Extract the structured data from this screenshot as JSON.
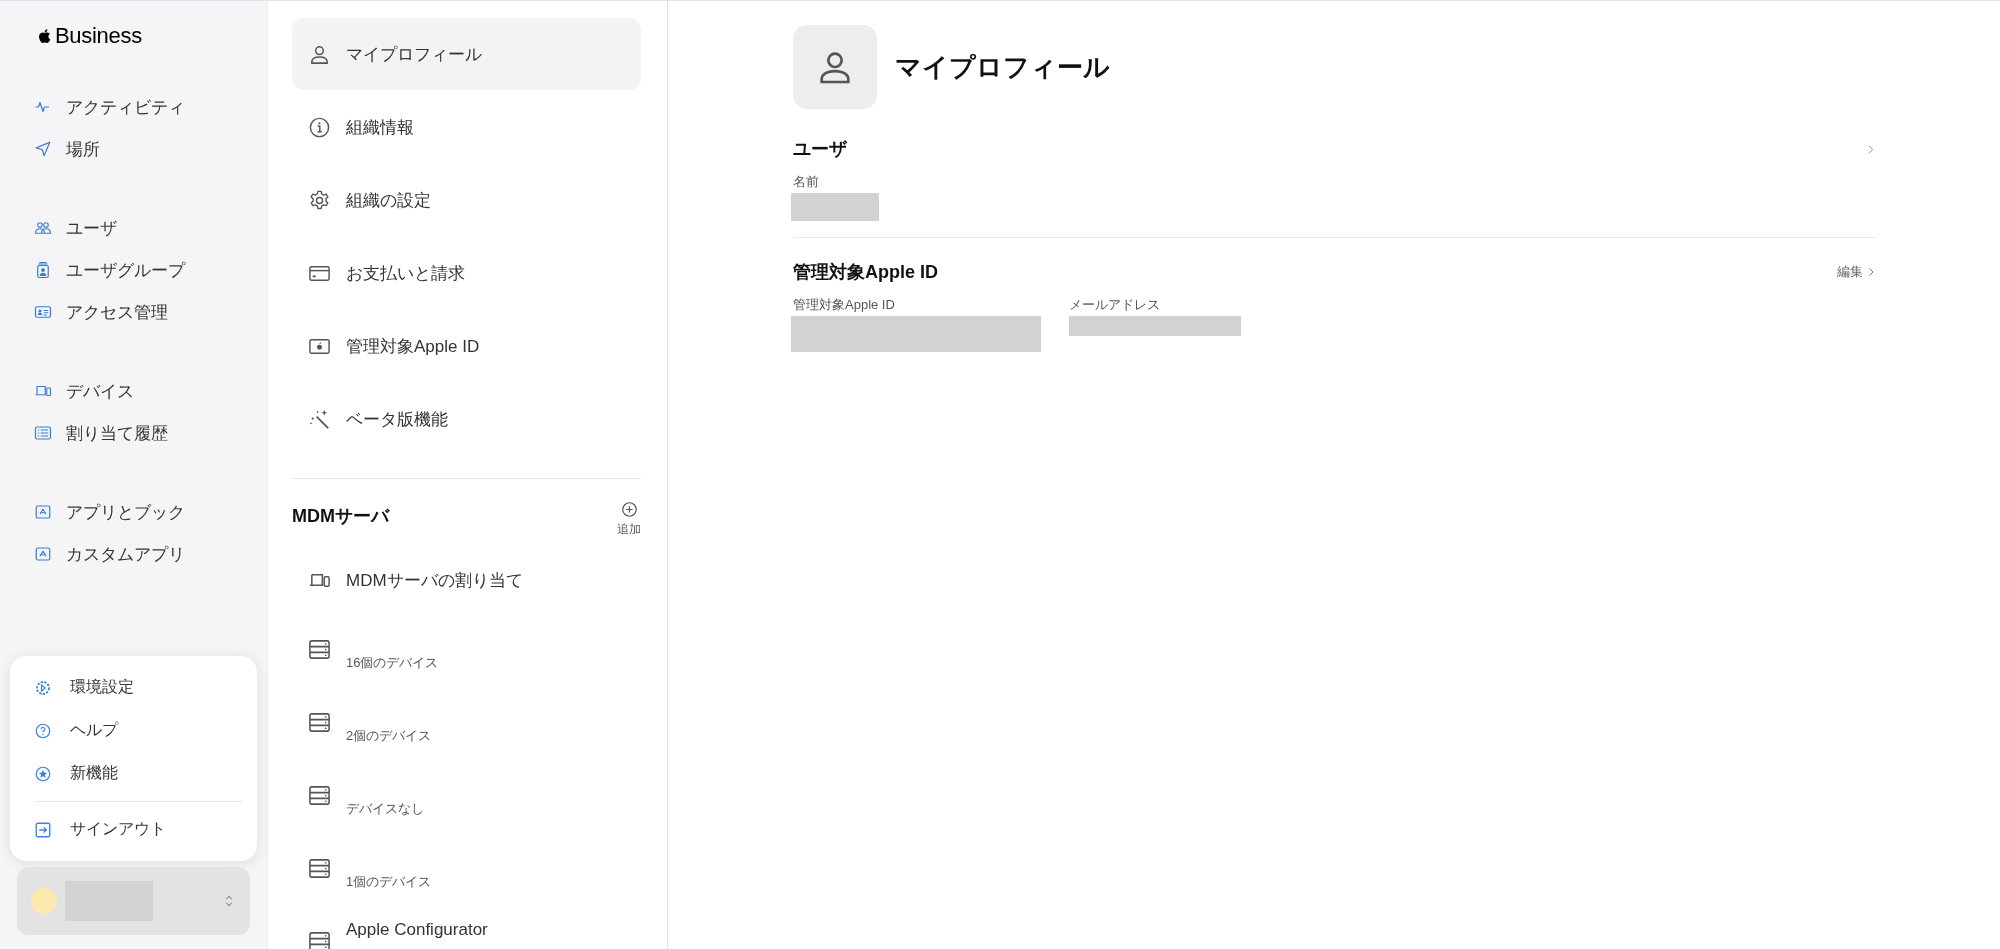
{
  "sidebar": {
    "logo": "Business",
    "groups": [
      {
        "items": [
          {
            "label": "アクティビティ"
          },
          {
            "label": "場所"
          }
        ]
      },
      {
        "items": [
          {
            "label": "ユーザ"
          },
          {
            "label": "ユーザグループ"
          },
          {
            "label": "アクセス管理"
          }
        ]
      },
      {
        "items": [
          {
            "label": "デバイス"
          },
          {
            "label": "割り当て履歴"
          }
        ]
      },
      {
        "items": [
          {
            "label": "アプリとブック"
          },
          {
            "label": "カスタムアプリ"
          }
        ]
      }
    ]
  },
  "popup_menu": {
    "items": [
      {
        "label": "環境設定"
      },
      {
        "label": "ヘルプ"
      },
      {
        "label": "新機能"
      }
    ],
    "sign_out": "サインアウト"
  },
  "settings_nav": {
    "items": [
      {
        "label": "マイプロフィール",
        "selected": true
      },
      {
        "label": "組織情報",
        "selected": false
      },
      {
        "label": "組織の設定",
        "selected": false
      },
      {
        "label": "お支払いと請求",
        "selected": false
      },
      {
        "label": "管理対象Apple ID",
        "selected": false
      },
      {
        "label": "ベータ版機能",
        "selected": false
      }
    ]
  },
  "mdm": {
    "title": "MDMサーバ",
    "add_label": "追加",
    "items": [
      {
        "kind": "assign",
        "label": "MDMサーバの割り当て"
      },
      {
        "kind": "server",
        "subtitle": "16個のデバイス"
      },
      {
        "kind": "server",
        "subtitle": "2個のデバイス"
      },
      {
        "kind": "server",
        "subtitle": "デバイスなし"
      },
      {
        "kind": "server",
        "subtitle": "1個のデバイス"
      },
      {
        "kind": "server",
        "label": "Apple Configurator"
      }
    ]
  },
  "profile": {
    "title": "マイプロフィール",
    "sections": [
      {
        "kind": "user",
        "title": "ユーザ",
        "fields": [
          {
            "label": "名前"
          }
        ]
      },
      {
        "kind": "apple_id",
        "title": "管理対象Apple ID",
        "action": "編集",
        "fields": [
          {
            "label": "管理対象Apple ID"
          },
          {
            "label": "メールアドレス"
          }
        ]
      }
    ]
  }
}
